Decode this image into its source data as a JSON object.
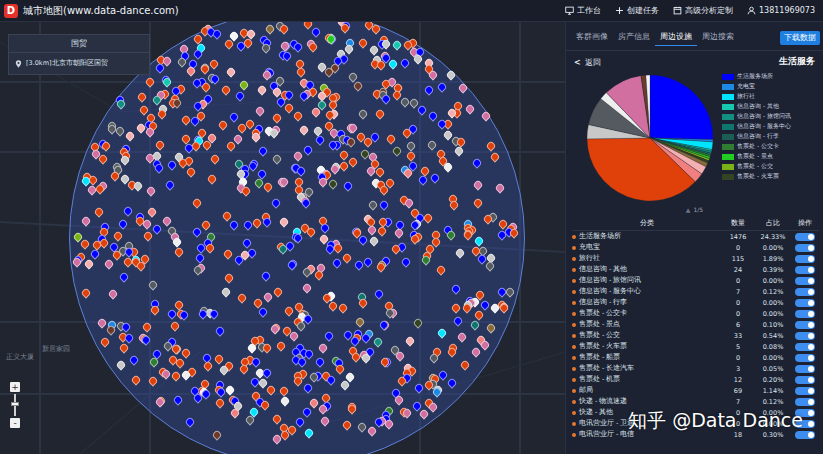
{
  "app": {
    "logo": "D",
    "title": "城市地图(www.data-dance.com)"
  },
  "header_actions": [
    {
      "label": "工作台"
    },
    {
      "label": "创建任务"
    },
    {
      "label": "高级分析定制"
    },
    {
      "label": "13811969073"
    }
  ],
  "search_card": {
    "title": "国贸",
    "result": "[3.0km]北京市朝阳区国贸"
  },
  "map_labels": [
    "正义大厦",
    "新居家园"
  ],
  "zoom": {
    "in": "+",
    "out": "-"
  },
  "tabs": [
    {
      "label": "客群画像",
      "selected": false
    },
    {
      "label": "房产信息",
      "selected": false
    },
    {
      "label": "周边设施",
      "selected": true
    },
    {
      "label": "周边搜索",
      "selected": false
    }
  ],
  "download_button": "下载数据",
  "back": {
    "icon": "<",
    "label": "返回"
  },
  "category_title": "生活服务",
  "pie": {
    "values": [
      24.33,
      0.6,
      1.89,
      0.39,
      0.5,
      0.4,
      0.5,
      0.5,
      0.54,
      0.6,
      1.0,
      2.0,
      2.5,
      36.0,
      3.5,
      7.0,
      2.0,
      9.5,
      1.2,
      1.0
    ],
    "colors": [
      "#0000ff",
      "#1e88e5",
      "#00e5ff",
      "#16c8b0",
      "#128f80",
      "#0f766e",
      "#2e7d32",
      "#22cc22",
      "#7ab317",
      "#334422",
      "#8a6a3a",
      "#f4b0b0",
      "#f08080",
      "#e0400a",
      "#c8c8c8",
      "#555a60",
      "#eeeeee",
      "#d06fa0",
      "#6b3a2a",
      "#f5f5f5"
    ]
  },
  "legend": [
    {
      "label": "生活服务场所",
      "color": "#0000ff"
    },
    {
      "label": "充电宝",
      "color": "#1e88e5"
    },
    {
      "label": "旅行社",
      "color": "#00e5ff"
    },
    {
      "label": "信息咨询 - 其他",
      "color": "#16c8b0"
    },
    {
      "label": "信息咨询 - 旅馆问讯",
      "color": "#128f80"
    },
    {
      "label": "信息咨询 - 服务中心",
      "color": "#0f766e"
    },
    {
      "label": "信息咨询 - 行李",
      "color": "#1b5e55"
    },
    {
      "label": "售票处 - 公交卡",
      "color": "#2e7d32"
    },
    {
      "label": "售票处 - 景点",
      "color": "#22cc22"
    },
    {
      "label": "售票处 - 公交",
      "color": "#7ab317"
    },
    {
      "label": "售票处 - 火车票",
      "color": "#334422"
    }
  ],
  "pager": {
    "icon": "▲",
    "label": "1/5"
  },
  "table": {
    "columns": [
      "分类",
      "数量",
      "占比",
      "操作"
    ],
    "rows": [
      {
        "name": "生活服务场所",
        "count": "1476",
        "share": "24.33%",
        "on": true
      },
      {
        "name": "充电宝",
        "count": "0",
        "share": "0.00%",
        "on": true
      },
      {
        "name": "旅行社",
        "count": "115",
        "share": "1.89%",
        "on": true
      },
      {
        "name": "信息咨询 - 其他",
        "count": "24",
        "share": "0.39%",
        "on": true
      },
      {
        "name": "信息咨询 - 旅馆问讯",
        "count": "0",
        "share": "0.00%",
        "on": true
      },
      {
        "name": "信息咨询 - 服务中心",
        "count": "7",
        "share": "0.12%",
        "on": true
      },
      {
        "name": "信息咨询 - 行李",
        "count": "0",
        "share": "0.00%",
        "on": true
      },
      {
        "name": "售票处 - 公交卡",
        "count": "0",
        "share": "0.00%",
        "on": true
      },
      {
        "name": "售票处 - 景点",
        "count": "6",
        "share": "0.10%",
        "on": true
      },
      {
        "name": "售票处 - 公交",
        "count": "33",
        "share": "0.54%",
        "on": true
      },
      {
        "name": "售票处 - 火车票",
        "count": "5",
        "share": "0.08%",
        "on": true
      },
      {
        "name": "售票处 - 船票",
        "count": "0",
        "share": "0.00%",
        "on": true
      },
      {
        "name": "售票处 - 长途汽车",
        "count": "3",
        "share": "0.05%",
        "on": true
      },
      {
        "name": "售票处 - 机票",
        "count": "12",
        "share": "0.20%",
        "on": true
      },
      {
        "name": "邮局",
        "count": "69",
        "share": "1.14%",
        "on": true
      },
      {
        "name": "快递 - 物流速递",
        "count": "7",
        "share": "0.12%",
        "on": true
      },
      {
        "name": "快递 - 其他",
        "count": "0",
        "share": "0.00%",
        "on": true
      },
      {
        "name": "电讯营业厅 - 卫通",
        "count": "0",
        "share": "0.00%",
        "on": true
      },
      {
        "name": "电讯营业厅 - 电信",
        "count": "18",
        "share": "0.30%",
        "on": true
      }
    ]
  },
  "watermark": "知乎 @Data Dance"
}
